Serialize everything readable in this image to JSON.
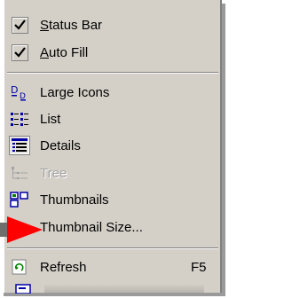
{
  "menu": {
    "items": [
      {
        "label": "Status Bar",
        "checked": true
      },
      {
        "label": "Auto Fill",
        "checked": true
      },
      {
        "label": "Large Icons",
        "icon": "large-icons-icon"
      },
      {
        "label": "List",
        "icon": "list-icon"
      },
      {
        "label": "Details",
        "icon": "details-icon",
        "selected": true
      },
      {
        "label": "Tree",
        "icon": "tree-icon",
        "disabled": true
      },
      {
        "label": "Thumbnails",
        "icon": "thumbnails-icon"
      },
      {
        "label": "Thumbnail Size...",
        "icon": "arrow-pointer-icon"
      },
      {
        "label": "Refresh",
        "icon": "refresh-icon",
        "shortcut": "F5"
      }
    ]
  },
  "colors": {
    "menu_bg": "#d4d0c8",
    "pointer_red": "#ff0000",
    "disabled_text": "#a3a3a3"
  }
}
